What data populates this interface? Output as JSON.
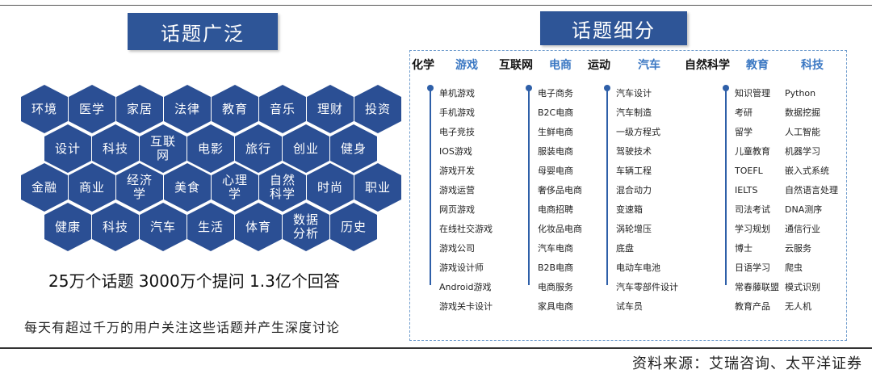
{
  "left": {
    "title": "话题广泛",
    "hex_rows": [
      [
        "环境",
        "医学",
        "家居",
        "法律",
        "教育",
        "音乐",
        "理财",
        "投资"
      ],
      [
        "设计",
        "科技",
        "互联网",
        "电影",
        "旅行",
        "创业",
        "健身"
      ],
      [
        "金融",
        "商业",
        "经济学",
        "美食",
        "心理学",
        "自然科学",
        "时尚",
        "职业"
      ],
      [
        "健康",
        "科技",
        "汽车",
        "生活",
        "体育",
        "数据分析",
        "历史"
      ]
    ],
    "stats": "25万个话题 3000万个提问  1.3亿个回答",
    "quote": "每天有超过千万的用户关注这些话题并产生深度讨论"
  },
  "right": {
    "title": "话题细分",
    "categories": [
      {
        "label": "化学",
        "color": "dark"
      },
      {
        "label": "游戏",
        "color": "blue"
      },
      {
        "label": "互联网",
        "color": "dark"
      },
      {
        "label": "电商",
        "color": "blue"
      },
      {
        "label": "运动",
        "color": "dark"
      },
      {
        "label": "汽车",
        "color": "blue"
      },
      {
        "label": "自然科学",
        "color": "dark"
      },
      {
        "label": "教育",
        "color": "blue"
      },
      {
        "label": "科技",
        "color": "blue"
      }
    ],
    "columns": [
      {
        "items": [
          "单机游戏",
          "手机游戏",
          "电子竞技",
          "IOS游戏",
          "游戏开发",
          "游戏运营",
          "网页游戏",
          "在线社交游戏",
          "游戏公司",
          "游戏设计师",
          "Android游戏",
          "游戏关卡设计"
        ]
      },
      {
        "items": [
          "电子商务",
          "B2C电商",
          "生鲜电商",
          "服装电商",
          "母婴电商",
          "奢侈品电商",
          "电商招聘",
          "化妆品电商",
          "汽车电商",
          "B2B电商",
          "电商服务",
          "家具电商"
        ]
      },
      {
        "items": [
          "汽车设计",
          "汽车制造",
          "一级方程式",
          "驾驶技术",
          "车辆工程",
          "混合动力",
          "变速箱",
          "涡轮增压",
          "底盘",
          "电动车电池",
          "汽车零部件设计",
          "试车员"
        ]
      }
    ],
    "edu_tech_pairs": [
      [
        "知识管理",
        "Python"
      ],
      [
        "考研",
        "数据挖掘"
      ],
      [
        "留学",
        "人工智能"
      ],
      [
        "儿童教育",
        "机器学习"
      ],
      [
        "TOEFL",
        "嵌入式系统"
      ],
      [
        "IELTS",
        "自然语言处理"
      ],
      [
        "司法考试",
        "DNA测序"
      ],
      [
        "学习规划",
        "通信行业"
      ],
      [
        "博士",
        "云服务"
      ],
      [
        "日语学习",
        "爬虫"
      ],
      [
        "常春藤联盟",
        "模式识别"
      ],
      [
        "教育产品",
        "无人机"
      ]
    ]
  },
  "source": "资料来源：艾瑞咨询、太平洋证券",
  "colors": {
    "hex_fill": "#2b4f94",
    "title_fill": "#2e5597",
    "category_blue": "#3b78c3",
    "panel_border": "#6f9ccd"
  }
}
